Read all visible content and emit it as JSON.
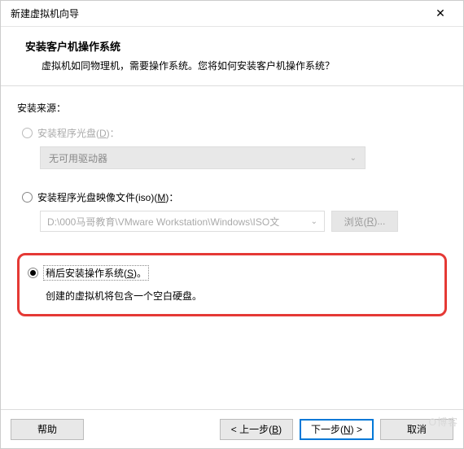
{
  "window": {
    "title": "新建虚拟机向导"
  },
  "header": {
    "title": "安装客户机操作系统",
    "subtitle": "虚拟机如同物理机，需要操作系统。您将如何安装客户机操作系统？"
  },
  "source_label": "安装来源：",
  "option_disc": {
    "label_prefix": "安装程序光盘(",
    "accel": "D",
    "label_suffix": ")：",
    "dropdown_text": "无可用驱动器"
  },
  "option_iso": {
    "label_prefix": "安装程序光盘映像文件(iso)(",
    "accel": "M",
    "label_suffix": ")：",
    "path": "D:\\000马哥教育\\VMware Workstation\\Windows\\ISO文",
    "browse_prefix": "浏览(",
    "browse_accel": "R",
    "browse_suffix": ")..."
  },
  "option_later": {
    "label_prefix": "稍后安装操作系统(",
    "accel": "S",
    "label_suffix": ")。",
    "description": "创建的虚拟机将包含一个空白硬盘。"
  },
  "footer": {
    "help": "帮助",
    "back_prefix": "< 上一步(",
    "back_accel": "B",
    "back_suffix": ")",
    "next_prefix": "下一步(",
    "next_accel": "N",
    "next_suffix": ") >",
    "cancel": "取消"
  },
  "watermark": "O博客"
}
